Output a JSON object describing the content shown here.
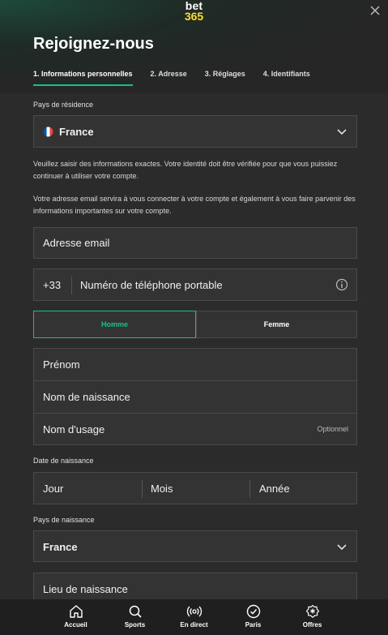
{
  "logo": {
    "line1": "bet",
    "line2": "365"
  },
  "title": "Rejoignez-nous",
  "steps": [
    {
      "label": "1. Informations personnelles",
      "active": true
    },
    {
      "label": "2. Adresse"
    },
    {
      "label": "3. Réglages"
    },
    {
      "label": "4. Identifiants"
    }
  ],
  "residence": {
    "label": "Pays de résidence",
    "value": "France"
  },
  "info1": "Veuillez saisir des informations exactes. Votre identité doit être vérifiée pour que vous puissiez continuer à utiliser votre compte.",
  "info2": "Votre adresse email servira à vous connecter à votre compte et également à vous faire parvenir des informations importantes sur votre compte.",
  "email": {
    "placeholder": "Adresse email"
  },
  "phone": {
    "prefix": "+33",
    "placeholder": "Numéro de téléphone portable"
  },
  "gender": {
    "male": "Homme",
    "female": "Femme"
  },
  "names": {
    "first": "Prénom",
    "birth": "Nom de naissance",
    "usage": "Nom d'usage",
    "optional": "Optionnel"
  },
  "dob": {
    "label": "Date de naissance",
    "day": "Jour",
    "month": "Mois",
    "year": "Année"
  },
  "birth_country": {
    "label": "Pays de naissance",
    "value": "France"
  },
  "birth_place": {
    "placeholder": "Lieu de naissance"
  },
  "nav": [
    {
      "label": "Accueil",
      "icon": "home-icon"
    },
    {
      "label": "Sports",
      "icon": "search-icon"
    },
    {
      "label": "En direct",
      "icon": "live-icon"
    },
    {
      "label": "Paris",
      "icon": "check-circle-icon"
    },
    {
      "label": "Offres",
      "icon": "offers-icon"
    }
  ],
  "colors": {
    "accent": "#14c08e",
    "brand_yellow": "#ffdf1b",
    "background": "#2b2b2b"
  }
}
